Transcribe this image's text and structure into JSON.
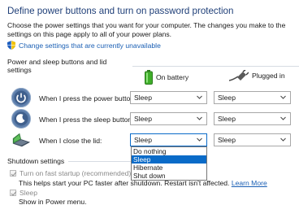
{
  "header": {
    "title": "Define power buttons and turn on password protection",
    "description": "Choose the power settings that you want for your computer. The changes you make to the settings on this page apply to all of your power plans.",
    "change_link": "Change settings that are currently unavailable"
  },
  "power_group": {
    "title": "Power and sleep buttons and lid settings",
    "col_battery": "On battery",
    "col_plugged": "Plugged in",
    "rows": [
      {
        "label": "When I press the power button:",
        "battery": "Sleep",
        "plugged": "Sleep"
      },
      {
        "label": "When I press the sleep button:",
        "battery": "Sleep",
        "plugged": "Sleep"
      },
      {
        "label": "When I close the lid:",
        "battery": "Sleep",
        "plugged": "Sleep"
      }
    ]
  },
  "dropdown": {
    "options": [
      "Do nothing",
      "Sleep",
      "Hibernate",
      "Shut down"
    ],
    "selected": "Sleep"
  },
  "shutdown_group": {
    "title": "Shutdown settings",
    "fast_startup_label": "Turn on fast startup (recommended)",
    "fast_startup_desc": "This helps start your PC faster after shutdown. Restart isn't affected.",
    "learn_more": "Learn More",
    "sleep_label": "Sleep",
    "sleep_desc": "Show in Power menu."
  },
  "colors": {
    "title": "#1f3f78",
    "link": "#1a5fb4",
    "selection": "#0a6bc8"
  }
}
